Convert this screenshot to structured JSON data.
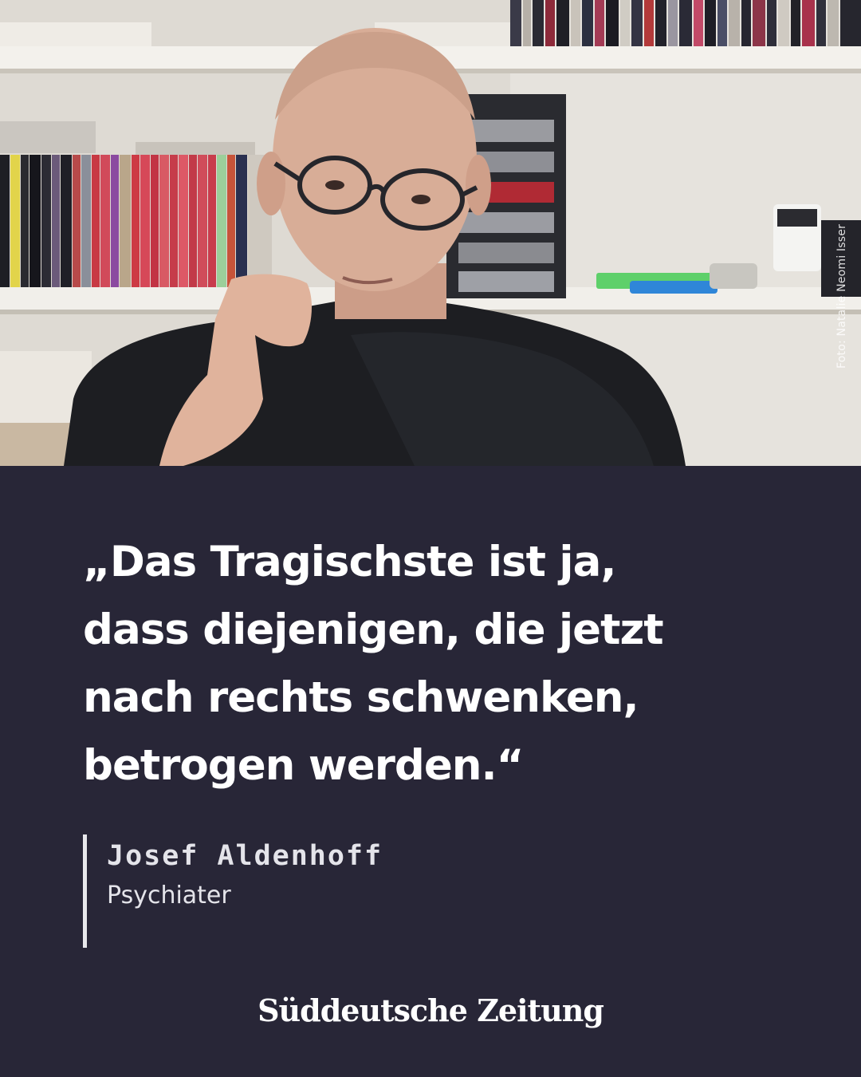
{
  "photo": {
    "alt": "",
    "credit": "Foto: Natalie Neomi Isser"
  },
  "quote": {
    "lines": [
      "„Das Tragischste ist ja,",
      "dass diejenigen, die jetzt",
      "nach rechts schwenken,",
      "betrogen werden.“"
    ]
  },
  "attribution": {
    "name": "Josef Aldenhoff",
    "role": "Psychiater"
  },
  "brand": {
    "logo_text": "Süddeutsche Zeitung"
  },
  "colors": {
    "panel_background": "#282637",
    "text": "#ffffff",
    "attribution_bar": "#e8e8ec"
  }
}
